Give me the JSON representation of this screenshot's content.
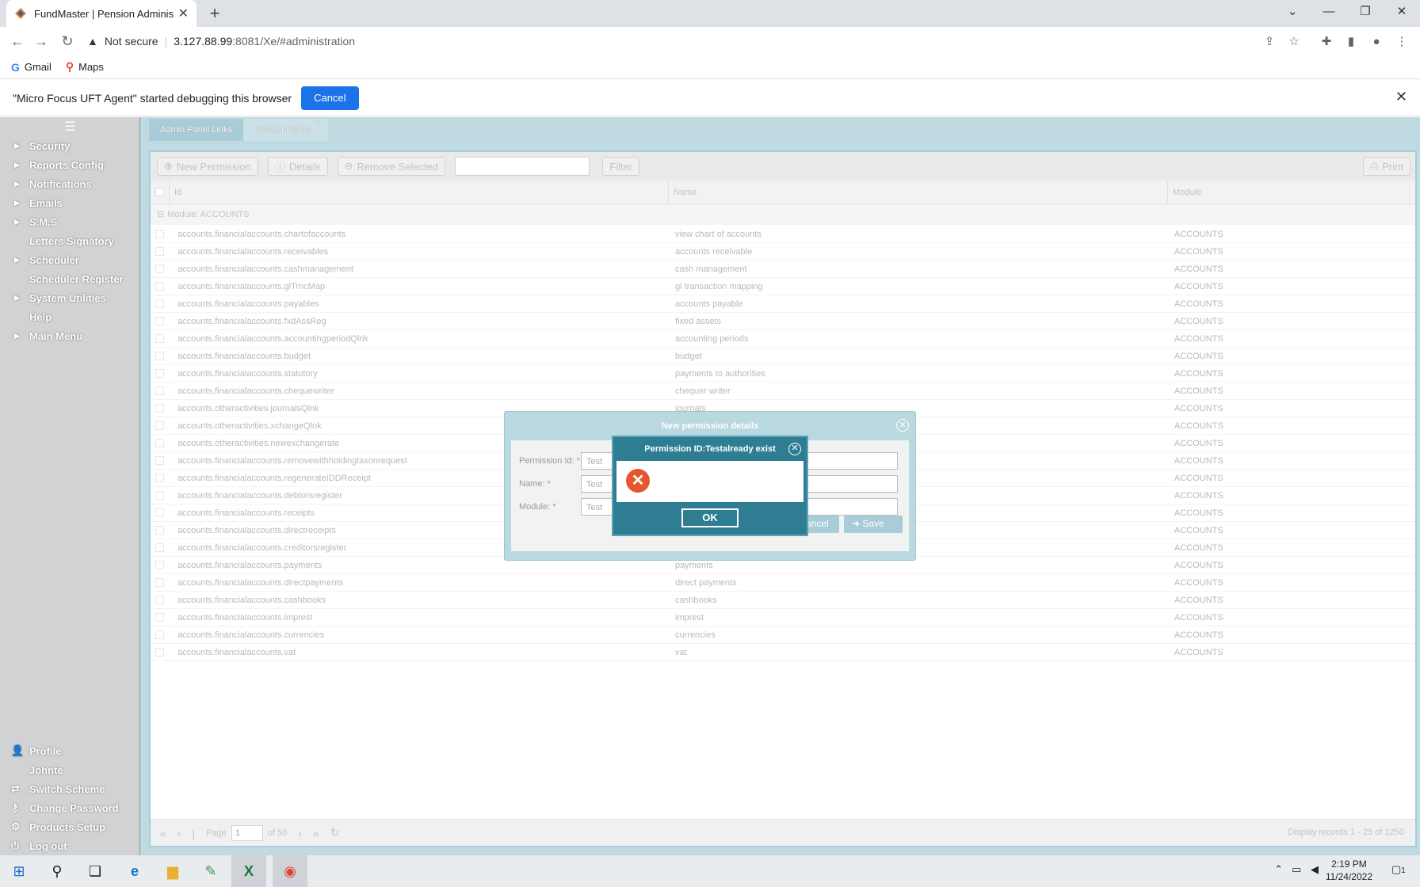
{
  "browser": {
    "tab_title": "FundMaster | Pension Administra",
    "new_tab": "+",
    "not_secure": "Not secure",
    "url_host": "3.127.88.99",
    "url_rest": ":8081/Xe/#administration",
    "bookmarks": [
      "Gmail",
      "Maps"
    ],
    "debug_message": "\"Micro Focus UFT Agent\" started debugging this browser",
    "debug_cancel": "Cancel"
  },
  "sidebar": {
    "items": [
      {
        "label": "Security",
        "expandable": true
      },
      {
        "label": "Reports Config",
        "expandable": true
      },
      {
        "label": "Notifications",
        "expandable": true
      },
      {
        "label": "Emails",
        "expandable": true
      },
      {
        "label": "S.M.S",
        "expandable": true
      },
      {
        "label": "Letters Signatory",
        "expandable": false
      },
      {
        "label": "Scheduler",
        "expandable": true
      },
      {
        "label": "Scheduler Register",
        "expandable": false
      },
      {
        "label": "System Utilities",
        "expandable": true
      },
      {
        "label": "Help",
        "expandable": false
      },
      {
        "label": "Main Menu",
        "expandable": true
      }
    ],
    "bottom": [
      {
        "label": "Profile",
        "icon": "user-icon"
      },
      {
        "label": "Johnte",
        "icon": ""
      },
      {
        "label": "Switch Scheme",
        "icon": "switch-icon"
      },
      {
        "label": "Change Password",
        "icon": "key-icon"
      },
      {
        "label": "Products Setup",
        "icon": "gears-icon"
      },
      {
        "label": "Log out",
        "icon": "power-icon"
      }
    ]
  },
  "tabs": [
    "Admin Panel Links",
    "System Rights"
  ],
  "toolbar": {
    "new_permission": "New Permission",
    "details": "Details",
    "remove_selected": "Remove Selected",
    "filter": "Filter",
    "print": "Print"
  },
  "grid": {
    "columns": [
      "Id",
      "Name",
      "Module"
    ],
    "group_label": "Module: ACCOUNTS",
    "rows": [
      [
        "accounts.financialaccounts.chartofaccounts",
        "view chart of accounts",
        "ACCOUNTS"
      ],
      [
        "accounts.financialaccounts.receivables",
        "accounts receivable",
        "ACCOUNTS"
      ],
      [
        "accounts.financialaccounts.cashmanagement",
        "cash management",
        "ACCOUNTS"
      ],
      [
        "accounts.financialaccounts.glTrncMap",
        "gl transaction mapping",
        "ACCOUNTS"
      ],
      [
        "accounts.financialaccounts.payables",
        "accounts payable",
        "ACCOUNTS"
      ],
      [
        "accounts.financialaccounts.fxdAssReg",
        "fixed assets",
        "ACCOUNTS"
      ],
      [
        "accounts.financialaccounts.accountingperiodQlnk",
        "accounting periods",
        "ACCOUNTS"
      ],
      [
        "accounts.financialaccounts.budget",
        "budget",
        "ACCOUNTS"
      ],
      [
        "accounts.financialaccounts.statutory",
        "payments to authorities",
        "ACCOUNTS"
      ],
      [
        "accounts.financialaccounts.chequewriter",
        "chequer writer",
        "ACCOUNTS"
      ],
      [
        "accounts.otheractivities.journalsQlnk",
        "journals",
        "ACCOUNTS"
      ],
      [
        "accounts.otheractivities.xchangeQlnk",
        "",
        "ACCOUNTS"
      ],
      [
        "accounts.otheractivities.newexchangerate",
        "",
        "ACCOUNTS"
      ],
      [
        "accounts.financialaccounts.removewithholdingtaxonrequest",
        "",
        "ACCOUNTS"
      ],
      [
        "accounts.financialaccounts.regenerateIDDReceipt",
        "",
        "ACCOUNTS"
      ],
      [
        "accounts.financialaccounts.debtorsregister",
        "",
        "ACCOUNTS"
      ],
      [
        "accounts.financialaccounts.receipts",
        "",
        "ACCOUNTS"
      ],
      [
        "accounts.financialaccounts.directreceipts",
        "",
        "ACCOUNTS"
      ],
      [
        "accounts.financialaccounts.creditorsregister",
        "",
        "ACCOUNTS"
      ],
      [
        "accounts.financialaccounts.payments",
        "payments",
        "ACCOUNTS"
      ],
      [
        "accounts.financialaccounts.directpayments",
        "direct payments",
        "ACCOUNTS"
      ],
      [
        "accounts.financialaccounts.cashbooks",
        "cashbooks",
        "ACCOUNTS"
      ],
      [
        "accounts.financialaccounts.imprest",
        "imprest",
        "ACCOUNTS"
      ],
      [
        "accounts.financialaccounts.currencies",
        "currencies",
        "ACCOUNTS"
      ],
      [
        "accounts.financialaccounts.vat",
        "vat",
        "ACCOUNTS"
      ]
    ]
  },
  "pager": {
    "page_label": "Page",
    "page_value": "1",
    "of_label": "of 50",
    "display": "Display records 1 - 25 of 1250"
  },
  "dialog_new": {
    "title": "New permission details",
    "fields": [
      {
        "label": "Permission Id:",
        "value": "Test"
      },
      {
        "label": "Name:",
        "value": "Test"
      },
      {
        "label": "Module:",
        "value": "Test"
      }
    ],
    "cancel": "Cancel",
    "save": "Save"
  },
  "dialog_error": {
    "title": "Permission ID:Testalready exist",
    "ok": "OK"
  },
  "taskbar": {
    "time": "2:19 PM",
    "date": "11/24/2022",
    "notifications": "1"
  }
}
